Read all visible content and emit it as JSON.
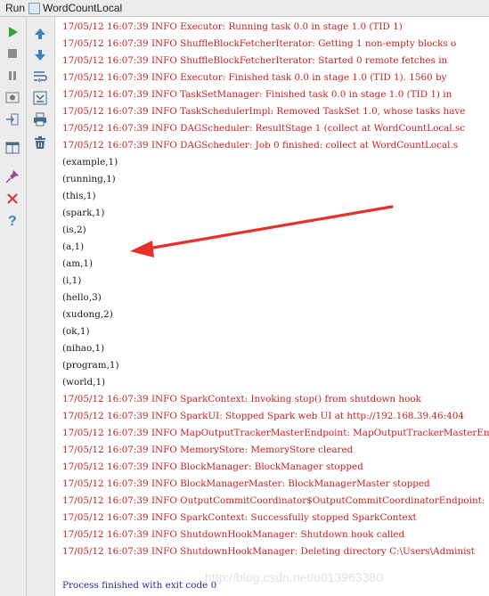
{
  "titlebar": {
    "run_label": "Run",
    "config_name": "WordCountLocal"
  },
  "toolbar_left": [
    {
      "name": "rerun-icon",
      "color": "#3aa336"
    },
    {
      "name": "stop-icon",
      "color": "#8c8c8c"
    },
    {
      "name": "pause-icon",
      "color": "#8c8c8c"
    },
    {
      "name": "dump-threads-icon",
      "color": "#7a7a7a"
    },
    {
      "name": "exit-icon",
      "color": "#5a7a9a"
    },
    {
      "name": "restore-layout-icon",
      "color": "#4a6a8a"
    },
    {
      "name": "pin-icon",
      "color": "#9a4a9a"
    },
    {
      "name": "close-icon",
      "color": "#d33b3b"
    },
    {
      "name": "help-icon",
      "color": "#3b82c4"
    }
  ],
  "toolbar_right": [
    {
      "name": "up-arrow-icon",
      "color": "#3b82c4"
    },
    {
      "name": "down-arrow-icon",
      "color": "#3b82c4"
    },
    {
      "name": "soft-wrap-icon",
      "color": "#4a6a8a"
    },
    {
      "name": "scroll-to-end-icon",
      "color": "#4a6a8a"
    },
    {
      "name": "print-icon",
      "color": "#4a6a8a"
    },
    {
      "name": "clear-all-icon",
      "color": "#4a6a8a"
    }
  ],
  "console_lines": [
    {
      "text": "17/05/12 16:07:39 INFO Executor: Running task 0.0 in stage 1.0 (TID 1)",
      "kind": "err"
    },
    {
      "text": "17/05/12 16:07:39 INFO ShuffleBlockFetcherIterator: Getting 1 non-empty blocks o",
      "kind": "err"
    },
    {
      "text": "17/05/12 16:07:39 INFO ShuffleBlockFetcherIterator: Started 0 remote fetches in",
      "kind": "err"
    },
    {
      "text": "17/05/12 16:07:39 INFO Executor: Finished task 0.0 in stage 1.0 (TID 1). 1560 by",
      "kind": "err"
    },
    {
      "text": "17/05/12 16:07:39 INFO TaskSetManager: Finished task 0.0 in stage 1.0 (TID 1) in",
      "kind": "err"
    },
    {
      "text": "17/05/12 16:07:39 INFO TaskSchedulerImpl: Removed TaskSet 1.0, whose tasks have",
      "kind": "err"
    },
    {
      "text": "17/05/12 16:07:39 INFO DAGScheduler: ResultStage 1 (collect at WordCountLocal.sc",
      "kind": "err"
    },
    {
      "text": "17/05/12 16:07:39 INFO DAGScheduler: Job 0 finished: collect at WordCountLocal.s",
      "kind": "err"
    },
    {
      "text": "(example,1)",
      "kind": "out"
    },
    {
      "text": "(running,1)",
      "kind": "out"
    },
    {
      "text": "(this,1)",
      "kind": "out"
    },
    {
      "text": "(spark,1)",
      "kind": "out"
    },
    {
      "text": "(is,2)",
      "kind": "out"
    },
    {
      "text": "(a,1)",
      "kind": "out"
    },
    {
      "text": "(am,1)",
      "kind": "out"
    },
    {
      "text": "(i,1)",
      "kind": "out"
    },
    {
      "text": "(hello,3)",
      "kind": "out"
    },
    {
      "text": "(xudong,2)",
      "kind": "out"
    },
    {
      "text": "(ok,1)",
      "kind": "out"
    },
    {
      "text": "(nihao,1)",
      "kind": "out"
    },
    {
      "text": "(program,1)",
      "kind": "out"
    },
    {
      "text": "(world,1)",
      "kind": "out"
    },
    {
      "text": "17/05/12 16:07:39 INFO SparkContext: Invoking stop() from shutdown hook",
      "kind": "err"
    },
    {
      "text": "17/05/12 16:07:39 INFO SparkUI: Stopped Spark web UI at http://192.168.39.46:404",
      "kind": "err"
    },
    {
      "text": "17/05/12 16:07:39 INFO MapOutputTrackerMasterEndpoint: MapOutputTrackerMasterEnd",
      "kind": "err"
    },
    {
      "text": "17/05/12 16:07:39 INFO MemoryStore: MemoryStore cleared",
      "kind": "err"
    },
    {
      "text": "17/05/12 16:07:39 INFO BlockManager: BlockManager stopped",
      "kind": "err"
    },
    {
      "text": "17/05/12 16:07:39 INFO BlockManagerMaster: BlockManagerMaster stopped",
      "kind": "err"
    },
    {
      "text": "17/05/12 16:07:39 INFO OutputCommitCoordinator$OutputCommitCoordinatorEndpoint:",
      "kind": "err"
    },
    {
      "text": "17/05/12 16:07:39 INFO SparkContext: Successfully stopped SparkContext",
      "kind": "err"
    },
    {
      "text": "17/05/12 16:07:39 INFO ShutdownHookManager: Shutdown hook called",
      "kind": "err"
    },
    {
      "text": "17/05/12 16:07:39 INFO ShutdownHookManager: Deleting directory C:\\Users\\Administ",
      "kind": "err"
    },
    {
      "text": "",
      "kind": "blank"
    },
    {
      "text": "Process finished with exit code 0",
      "kind": "exit"
    }
  ],
  "watermark": "http://blog.csdn.net/u013963380",
  "annotation_arrow_color": "#e8302a"
}
